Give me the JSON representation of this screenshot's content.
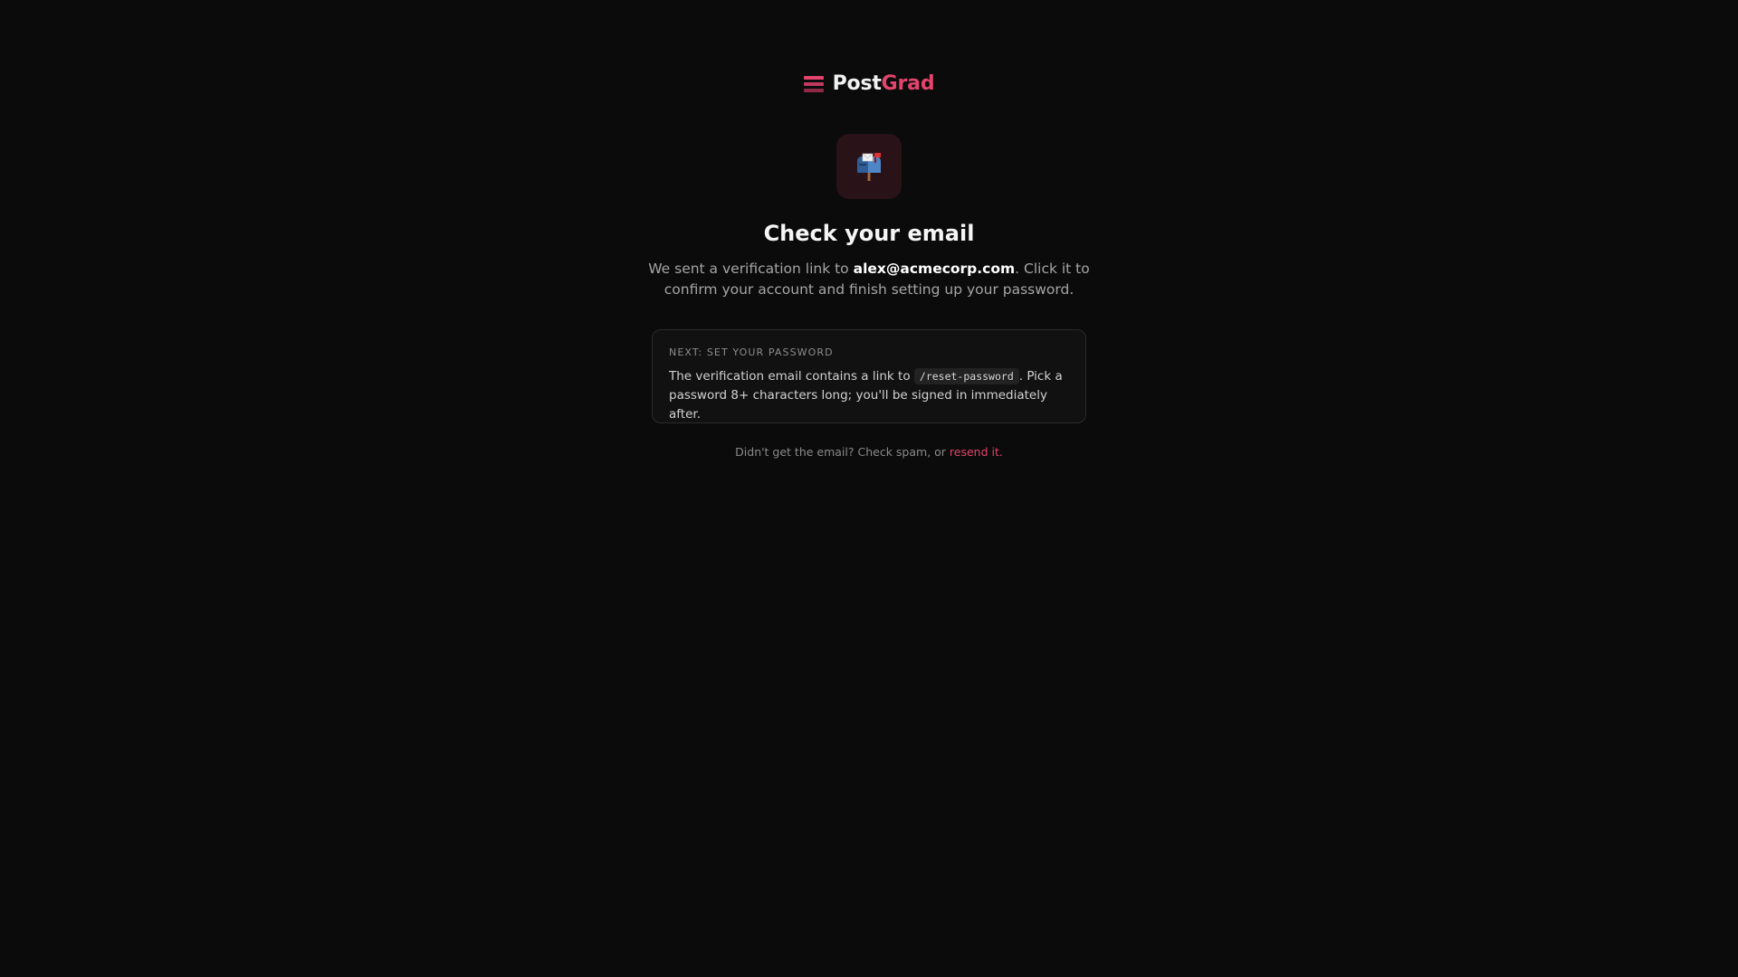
{
  "brand": {
    "name_part1": "Post",
    "name_part2": "Grad",
    "logo_icon": "stacked-bars-logo-icon",
    "accent_color": "#e2446c"
  },
  "hero": {
    "icon": "mailbox-icon",
    "icon_glyph": "📬",
    "tile_color": "#2a1219"
  },
  "heading": "Check your email",
  "description": {
    "prefix": "We sent a verification link to ",
    "email": "alex@acmecorp.com",
    "suffix": ". Click it to confirm your account and finish setting up your password."
  },
  "next_step": {
    "label": "NEXT: SET YOUR PASSWORD",
    "body_prefix": "The verification email contains a link to ",
    "code": "/reset-password",
    "body_suffix": ". Pick a password 8+ characters long; you'll be signed in immediately after."
  },
  "footer": {
    "text": "Didn't get the email? Check spam, or ",
    "link_label": "resend it."
  }
}
